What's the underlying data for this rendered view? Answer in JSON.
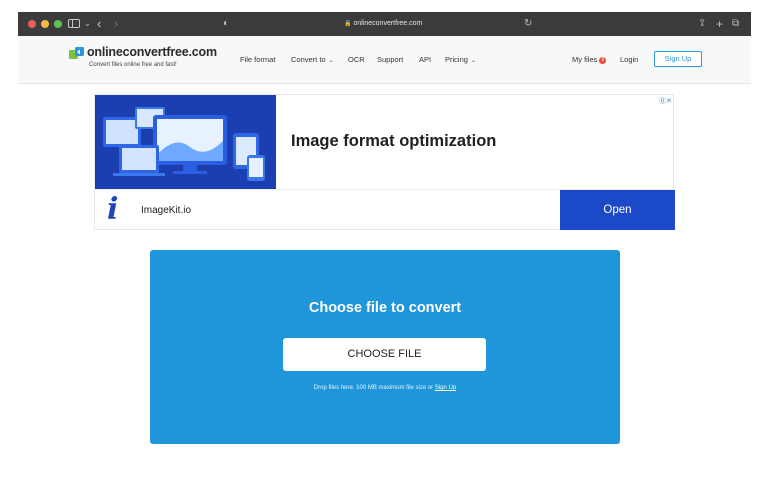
{
  "browser": {
    "address": "onlineconvertfree.com"
  },
  "header": {
    "logo_text": "onlineconvertfree.com",
    "tagline": "Convert files online free and fast!",
    "nav": {
      "file_format": "File format",
      "convert_to": "Convert to",
      "ocr": "OCR",
      "support": "Support",
      "api": "API",
      "pricing": "Pricing"
    },
    "my_files": "My files",
    "my_files_count": "6",
    "login": "Login",
    "sign_up": "Sign Up"
  },
  "ad": {
    "headline": "Image format optimization",
    "brand": "ImageKit.io",
    "cta": "Open",
    "brand_color": "#1b49c7"
  },
  "converter": {
    "title": "Choose file to convert",
    "button": "CHOOSE FILE",
    "drop_note_prefix": "Drop files here. 100 MB maximum file size or",
    "drop_note_link": "Sign Up",
    "accent_color": "#1e96d9"
  },
  "icons": {
    "titlebar": [
      "sidebar-icon",
      "back-icon",
      "forward-icon",
      "shield-icon",
      "lock-icon",
      "reload-icon",
      "share-icon",
      "new-tab-icon",
      "tabs-overview-icon"
    ]
  }
}
